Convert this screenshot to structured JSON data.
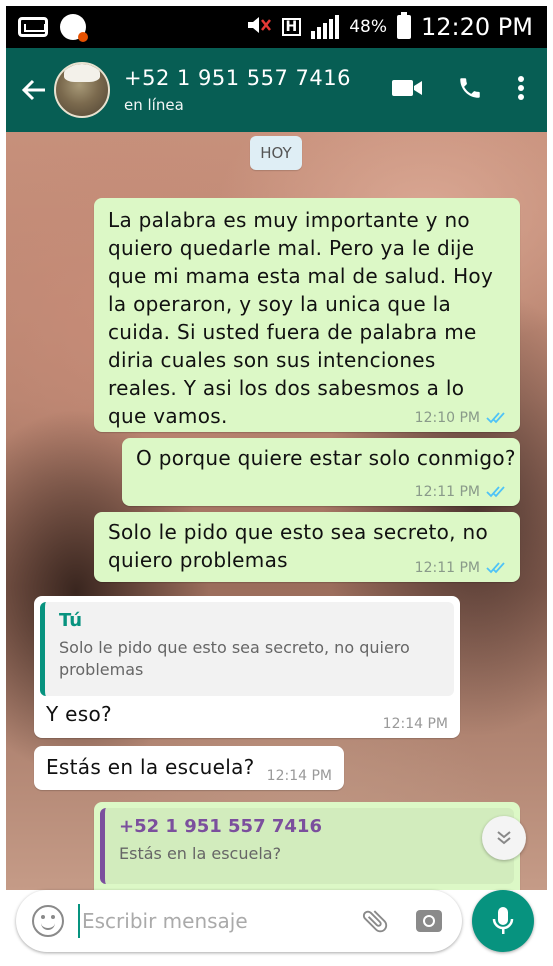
{
  "status_bar": {
    "battery": "48%",
    "time": "12:20 PM",
    "network": "H",
    "icons": [
      "voicemail-icon",
      "app-notification-icon",
      "mute-icon",
      "network-icon",
      "signal-icon",
      "battery-icon"
    ]
  },
  "header": {
    "contact_name": "+52 1 951 557 7416",
    "status": "en línea",
    "icons": [
      "back-arrow-icon",
      "video-call-icon",
      "phone-icon",
      "more-icon"
    ]
  },
  "chat": {
    "date_label": "HOY",
    "messages": [
      {
        "direction": "out",
        "text": "La palabra es muy importante y no quiero quedarle mal. Pero ya le dije que mi mama esta mal de salud. Hoy la operaron, y soy la unica que la cuida. Si usted fuera de palabra me diria cuales son sus intenciones reales. Y asi los dos sabesmos a lo que vamos.",
        "time": "12:10 PM"
      },
      {
        "direction": "out",
        "text": "O porque quiere estar solo conmigo?",
        "time": "12:11 PM"
      },
      {
        "direction": "out",
        "text": "Solo le pido que esto sea secreto, no quiero problemas",
        "time": "12:11 PM"
      },
      {
        "direction": "in",
        "quote_author": "Tú",
        "quote_text": "Solo le pido que esto sea secreto, no quiero problemas",
        "text": "Y eso?",
        "time": "12:14 PM"
      },
      {
        "direction": "in",
        "text": "Estás en la escuela?",
        "time": "12:14 PM"
      },
      {
        "direction": "out",
        "quote_author": "+52 1 951 557 7416",
        "quote_text": "Estás en la escuela?",
        "text": "",
        "time": ""
      }
    ]
  },
  "composer": {
    "placeholder": "Escribir mensaje",
    "icons": [
      "emoji-icon",
      "attach-icon",
      "camera-icon",
      "mic-icon"
    ]
  },
  "colors": {
    "header": "#075e54",
    "accent": "#07937f",
    "outgoing_bubble": "#dcf8c6",
    "incoming_bubble": "#ffffff",
    "read_ticks": "#4fc3f7"
  }
}
